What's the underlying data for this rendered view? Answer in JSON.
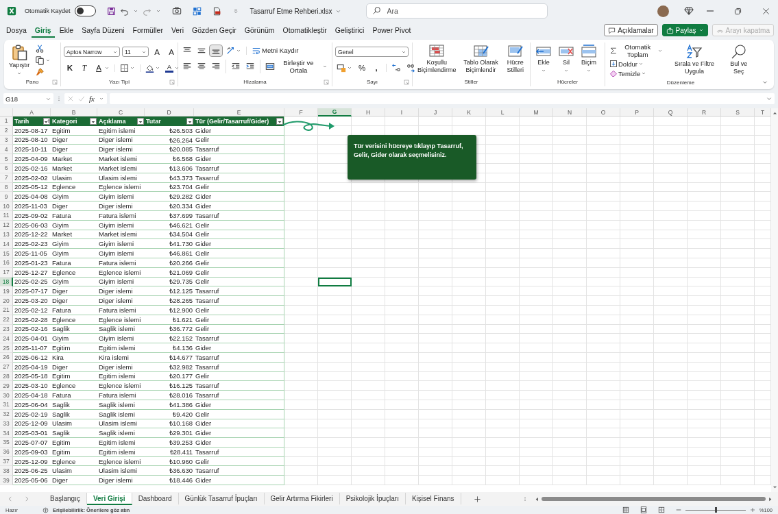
{
  "title_bar": {
    "autosave_label": "Otomatik Kaydet",
    "autosave_on": false,
    "file_name": "Tasarruf Etme Rehberi.xlsx",
    "search_placeholder": "Ara"
  },
  "menu_tabs": [
    {
      "label": "Dosya",
      "selected": false
    },
    {
      "label": "Giriş",
      "selected": true
    },
    {
      "label": "Ekle",
      "selected": false
    },
    {
      "label": "Sayfa Düzeni",
      "selected": false
    },
    {
      "label": "Formüller",
      "selected": false
    },
    {
      "label": "Veri",
      "selected": false
    },
    {
      "label": "Gözden Geçir",
      "selected": false
    },
    {
      "label": "Görünüm",
      "selected": false
    },
    {
      "label": "Otomatikleştir",
      "selected": false
    },
    {
      "label": "Geliştirici",
      "selected": false
    },
    {
      "label": "Power Pivot",
      "selected": false
    }
  ],
  "header_buttons": [
    {
      "kind": "comments",
      "label": "Açıklamalar",
      "disabled": false
    },
    {
      "kind": "share",
      "label": "Paylaş",
      "disabled": false
    },
    {
      "kind": "call",
      "label": "Arayı kapatma",
      "disabled": true
    }
  ],
  "ribbon": {
    "groups": [
      {
        "kind": "clipboard",
        "label": "Pano",
        "paste": "Yapıştır"
      },
      {
        "kind": "font",
        "label": "Yazı Tipi",
        "font_name": "Aptos Narrow",
        "font_size": "11",
        "grow": "A",
        "shrink": "A",
        "bold": "K",
        "italic": "T",
        "underline": "A",
        "font_color": "A"
      },
      {
        "kind": "alignment",
        "label": "Hizalama",
        "vertical_align": [
          {
            "selected": false
          },
          {
            "selected": false
          },
          {
            "selected": true
          }
        ],
        "wrap": "Metni Kaydır",
        "merge": "Birleştir ve Ortala"
      },
      {
        "kind": "number",
        "label": "Sayı",
        "format": "Genel",
        "percent": "%",
        "comma": ","
      },
      {
        "kind": "styles",
        "label": "Stiller",
        "buttons": [
          "Koşullu Biçimlendirme",
          "Tablo Olarak Biçimlendir",
          "Hücre Stilleri"
        ]
      },
      {
        "kind": "cells",
        "label": "Hücreler",
        "buttons": [
          "Ekle",
          "Sil",
          "Biçim"
        ]
      },
      {
        "kind": "editing",
        "label": "Düzenleme",
        "rows": [
          "Otomatik Toplam",
          "Doldur",
          "Temizle"
        ],
        "buttons": [
          "Sırala ve Filtre Uygula",
          "Bul ve Seç"
        ]
      }
    ]
  },
  "formula_bar": {
    "name_box": "G18",
    "fx": "fx"
  },
  "sheet": {
    "columns": [
      {
        "label": "A",
        "selected": false
      },
      {
        "label": "B",
        "selected": false
      },
      {
        "label": "C",
        "selected": false
      },
      {
        "label": "D",
        "selected": false
      },
      {
        "label": "E",
        "selected": false
      },
      {
        "label": "F",
        "selected": false
      },
      {
        "label": "G",
        "selected": true
      },
      {
        "label": "H",
        "selected": false
      },
      {
        "label": "I",
        "selected": false
      },
      {
        "label": "J",
        "selected": false
      },
      {
        "label": "K",
        "selected": false
      },
      {
        "label": "L",
        "selected": false
      },
      {
        "label": "M",
        "selected": false
      },
      {
        "label": "N",
        "selected": false
      },
      {
        "label": "O",
        "selected": false
      },
      {
        "label": "P",
        "selected": false
      },
      {
        "label": "Q",
        "selected": false
      },
      {
        "label": "R",
        "selected": false
      },
      {
        "label": "S",
        "selected": false
      },
      {
        "label": "T",
        "selected": false
      }
    ],
    "header_row_number": "1",
    "table_header": [
      {
        "label": "Tarih",
        "sorted": true
      },
      {
        "label": "Kategori",
        "sorted": false
      },
      {
        "label": "Açıklama",
        "sorted": false
      },
      {
        "label": "Tutar",
        "sorted": false
      },
      {
        "label": "Tür (Gelir/Tasarruf/Gider)",
        "sorted": false
      }
    ],
    "rows": [
      {
        "number": "2",
        "selected": false,
        "cells": [
          "2025-08-17",
          "Egitim",
          "Egitim islemi",
          "₺26.503",
          "Gider"
        ]
      },
      {
        "number": "3",
        "selected": false,
        "cells": [
          "2025-08-10",
          "Diger",
          "Diger islemi",
          "₺26.264",
          "Gelir"
        ]
      },
      {
        "number": "4",
        "selected": false,
        "cells": [
          "2025-10-11",
          "Diger",
          "Diger islemi",
          "₺20.085",
          "Tasarruf"
        ]
      },
      {
        "number": "5",
        "selected": false,
        "cells": [
          "2025-04-09",
          "Market",
          "Market islemi",
          "₺6.568",
          "Gider"
        ]
      },
      {
        "number": "6",
        "selected": false,
        "cells": [
          "2025-02-16",
          "Market",
          "Market islemi",
          "₺13.606",
          "Tasarruf"
        ]
      },
      {
        "number": "7",
        "selected": false,
        "cells": [
          "2025-02-02",
          "Ulasim",
          "Ulasim islemi",
          "₺43.373",
          "Tasarruf"
        ]
      },
      {
        "number": "8",
        "selected": false,
        "cells": [
          "2025-05-12",
          "Eglence",
          "Eglence islemi",
          "₺23.704",
          "Gelir"
        ]
      },
      {
        "number": "9",
        "selected": false,
        "cells": [
          "2025-04-08",
          "Giyim",
          "Giyim islemi",
          "₺29.282",
          "Gider"
        ]
      },
      {
        "number": "10",
        "selected": false,
        "cells": [
          "2025-11-03",
          "Diger",
          "Diger islemi",
          "₺20.334",
          "Gider"
        ]
      },
      {
        "number": "11",
        "selected": false,
        "cells": [
          "2025-09-02",
          "Fatura",
          "Fatura islemi",
          "₺37.699",
          "Tasarruf"
        ]
      },
      {
        "number": "12",
        "selected": false,
        "cells": [
          "2025-06-03",
          "Giyim",
          "Giyim islemi",
          "₺46.621",
          "Gelir"
        ]
      },
      {
        "number": "13",
        "selected": false,
        "cells": [
          "2025-12-22",
          "Market",
          "Market islemi",
          "₺34.504",
          "Gelir"
        ]
      },
      {
        "number": "14",
        "selected": false,
        "cells": [
          "2025-02-23",
          "Giyim",
          "Giyim islemi",
          "₺41.730",
          "Gider"
        ]
      },
      {
        "number": "15",
        "selected": false,
        "cells": [
          "2025-11-05",
          "Giyim",
          "Giyim islemi",
          "₺46.861",
          "Gelir"
        ]
      },
      {
        "number": "16",
        "selected": false,
        "cells": [
          "2025-01-23",
          "Fatura",
          "Fatura islemi",
          "₺20.266",
          "Gelir"
        ]
      },
      {
        "number": "17",
        "selected": false,
        "cells": [
          "2025-12-27",
          "Eglence",
          "Eglence islemi",
          "₺21.069",
          "Gelir"
        ]
      },
      {
        "number": "18",
        "selected": true,
        "cells": [
          "2025-02-25",
          "Giyim",
          "Giyim islemi",
          "₺29.735",
          "Gelir"
        ]
      },
      {
        "number": "19",
        "selected": false,
        "cells": [
          "2025-07-17",
          "Diger",
          "Diger islemi",
          "₺12.125",
          "Tasarruf"
        ]
      },
      {
        "number": "20",
        "selected": false,
        "cells": [
          "2025-03-20",
          "Diger",
          "Diger islemi",
          "₺28.265",
          "Tasarruf"
        ]
      },
      {
        "number": "21",
        "selected": false,
        "cells": [
          "2025-02-12",
          "Fatura",
          "Fatura islemi",
          "₺12.900",
          "Gelir"
        ]
      },
      {
        "number": "22",
        "selected": false,
        "cells": [
          "2025-02-28",
          "Eglence",
          "Eglence islemi",
          "₺1.621",
          "Gelir"
        ]
      },
      {
        "number": "23",
        "selected": false,
        "cells": [
          "2025-02-16",
          "Saglik",
          "Saglik islemi",
          "₺36.772",
          "Gelir"
        ]
      },
      {
        "number": "24",
        "selected": false,
        "cells": [
          "2025-04-01",
          "Giyim",
          "Giyim islemi",
          "₺22.152",
          "Tasarruf"
        ]
      },
      {
        "number": "25",
        "selected": false,
        "cells": [
          "2025-11-07",
          "Egitim",
          "Egitim islemi",
          "₺4.136",
          "Gider"
        ]
      },
      {
        "number": "26",
        "selected": false,
        "cells": [
          "2025-06-12",
          "Kira",
          "Kira islemi",
          "₺14.677",
          "Tasarruf"
        ]
      },
      {
        "number": "27",
        "selected": false,
        "cells": [
          "2025-04-19",
          "Diger",
          "Diger islemi",
          "₺32.982",
          "Tasarruf"
        ]
      },
      {
        "number": "28",
        "selected": false,
        "cells": [
          "2025-05-18",
          "Egitim",
          "Egitim islemi",
          "₺20.177",
          "Gelir"
        ]
      },
      {
        "number": "29",
        "selected": false,
        "cells": [
          "2025-03-10",
          "Eglence",
          "Eglence islemi",
          "₺16.125",
          "Tasarruf"
        ]
      },
      {
        "number": "30",
        "selected": false,
        "cells": [
          "2025-04-18",
          "Fatura",
          "Fatura islemi",
          "₺28.016",
          "Tasarruf"
        ]
      },
      {
        "number": "31",
        "selected": false,
        "cells": [
          "2025-06-04",
          "Saglik",
          "Saglik islemi",
          "₺41.386",
          "Gider"
        ]
      },
      {
        "number": "32",
        "selected": false,
        "cells": [
          "2025-02-19",
          "Saglik",
          "Saglik islemi",
          "₺9.420",
          "Gelir"
        ]
      },
      {
        "number": "33",
        "selected": false,
        "cells": [
          "2025-12-09",
          "Ulasim",
          "Ulasim islemi",
          "₺10.168",
          "Gider"
        ]
      },
      {
        "number": "34",
        "selected": false,
        "cells": [
          "2025-03-01",
          "Saglik",
          "Saglik islemi",
          "₺29.301",
          "Gider"
        ]
      },
      {
        "number": "35",
        "selected": false,
        "cells": [
          "2025-07-07",
          "Egitim",
          "Egitim islemi",
          "₺39.253",
          "Gider"
        ]
      },
      {
        "number": "36",
        "selected": false,
        "cells": [
          "2025-09-03",
          "Egitim",
          "Egitim islemi",
          "₺28.411",
          "Tasarruf"
        ]
      },
      {
        "number": "37",
        "selected": false,
        "cells": [
          "2025-12-09",
          "Eglence",
          "Eglence islemi",
          "₺10.960",
          "Gelir"
        ]
      },
      {
        "number": "38",
        "selected": false,
        "cells": [
          "2025-06-25",
          "Ulasim",
          "Ulasim islemi",
          "₺36.630",
          "Tasarruf"
        ]
      },
      {
        "number": "39",
        "selected": false,
        "cells": [
          "2025-05-06",
          "Diger",
          "Diger islemi",
          "₺18.446",
          "Gider"
        ]
      }
    ],
    "callout": {
      "text": "Tür verisini hücreye tıklayıp Tasarruf, Gelir, Gider olarak seçmelisiniz."
    }
  },
  "sheet_tabs": [
    {
      "label": "Başlangıç",
      "selected": false
    },
    {
      "label": "Veri Girişi",
      "selected": true
    },
    {
      "label": "Dashboard",
      "selected": false
    },
    {
      "label": "Günlük Tasarruf İpuçları",
      "selected": false
    },
    {
      "label": "Gelir Artırma Fikirleri",
      "selected": false
    },
    {
      "label": "Psikolojik İpuçları",
      "selected": false
    },
    {
      "label": "Kişisel Finans",
      "selected": false
    }
  ],
  "status_bar": {
    "ready": "Hazır",
    "accessibility": "Erişilebilirlik: Önerilere göz atın",
    "zoom": "%100",
    "level": 0.5
  }
}
